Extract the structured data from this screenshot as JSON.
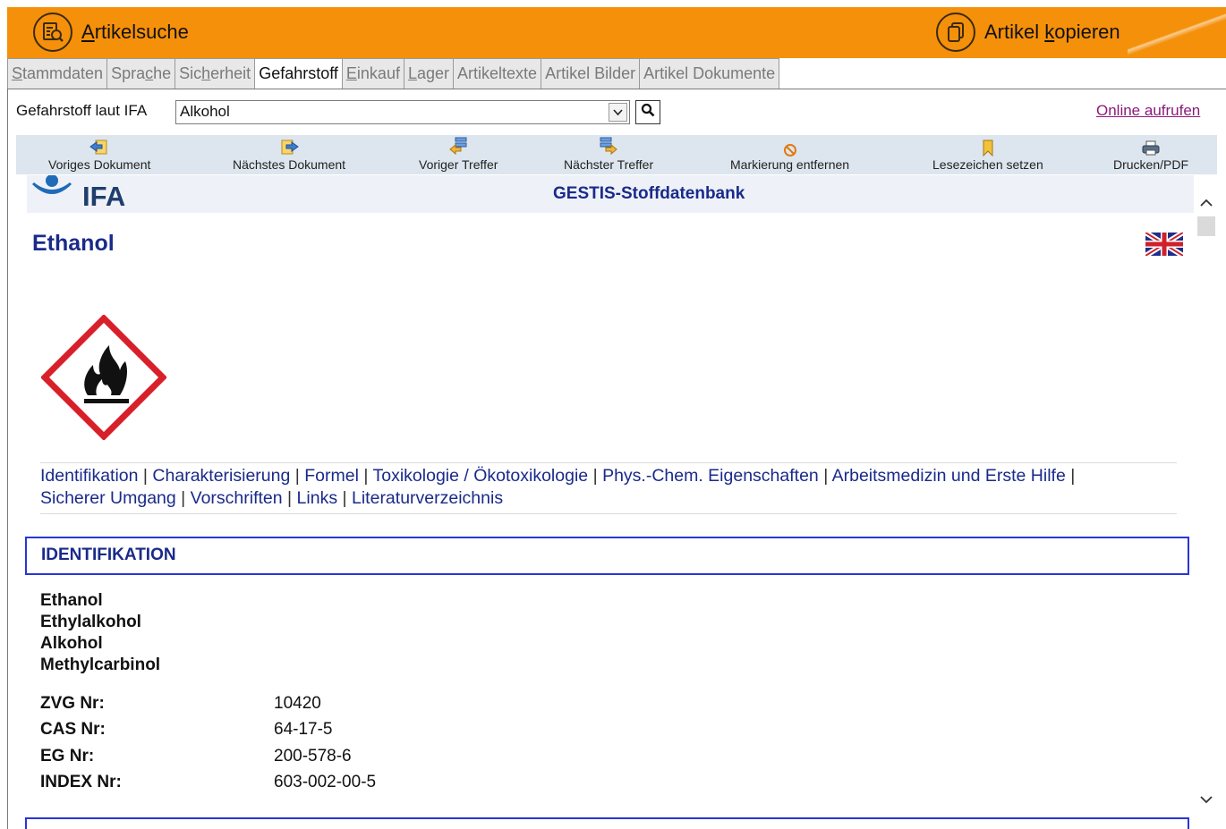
{
  "topbar": {
    "article_search": {
      "prefix": "",
      "underline": "A",
      "rest": "rtikelsuche",
      "icon": "search-document-icon"
    },
    "article_copy": {
      "prefix": "Artikel ",
      "underline": "k",
      "rest": "opieren",
      "icon": "copy-document-icon"
    },
    "color": "#f5900a"
  },
  "tabs": [
    {
      "pre": "",
      "ul": "S",
      "post": "tammdaten",
      "active": false
    },
    {
      "pre": "Spra",
      "ul": "c",
      "post": "he",
      "active": false
    },
    {
      "pre": "Sic",
      "ul": "h",
      "post": "erheit",
      "active": false
    },
    {
      "pre": "Gefahrstoff",
      "ul": "",
      "post": "",
      "active": true
    },
    {
      "pre": "",
      "ul": "E",
      "post": "inkauf",
      "active": false
    },
    {
      "pre": "",
      "ul": "L",
      "post": "ager",
      "active": false
    },
    {
      "pre": "Artikeltexte",
      "ul": "",
      "post": "",
      "active": false
    },
    {
      "pre": "Artikel Bilder",
      "ul": "",
      "post": "",
      "active": false
    },
    {
      "pre": "Artikel Dokumente",
      "ul": "",
      "post": "",
      "active": false
    }
  ],
  "search": {
    "label": "Gefahrstoff laut IFA",
    "value": "Alkohol",
    "online_link": "Online aufrufen"
  },
  "toolbar": {
    "prev_doc": "Voriges Dokument",
    "next_doc": "Nächstes Dokument",
    "prev_hit": "Voriger Treffer",
    "next_hit": "Nächster Treffer",
    "clear_marks": "Markierung entfernen",
    "bookmark": "Lesezeichen setzen",
    "print": "Drucken/PDF"
  },
  "document": {
    "logo_text": "IFA",
    "database_title": "GESTIS-Stoffdatenbank",
    "substance": "Ethanol",
    "nav_links": [
      "Identifikation",
      "Charakterisierung",
      "Formel",
      "Toxikologie / Ökotoxikologie",
      "Phys.-Chem. Eigenschaften",
      "Arbeitsmedizin und Erste Hilfe",
      "Sicherer Umgang",
      "Vorschriften",
      "Links",
      "Literaturverzeichnis"
    ],
    "section_title": "IDENTIFIKATION",
    "names": [
      "Ethanol",
      "Ethylalkohol",
      "Alkohol",
      "Methylcarbinol"
    ],
    "identifiers": [
      {
        "label": "ZVG Nr:",
        "value": "10420"
      },
      {
        "label": "CAS Nr:",
        "value": "64-17-5"
      },
      {
        "label": "EG Nr:",
        "value": "200-578-6"
      },
      {
        "label": "INDEX Nr:",
        "value": "603-002-00-5"
      }
    ],
    "pictogram": "ghs-flammable-icon",
    "language_flag": "uk-flag-icon"
  }
}
